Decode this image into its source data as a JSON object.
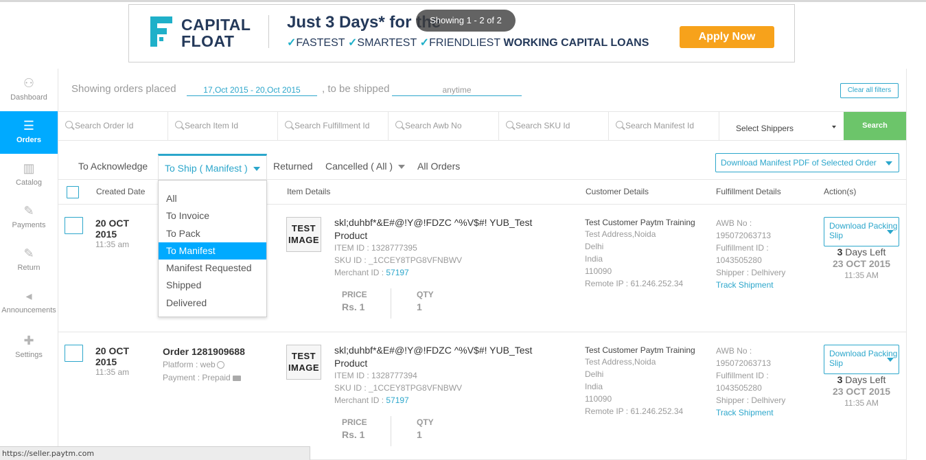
{
  "banner": {
    "logo_line1": "CAPITAL",
    "logo_line2": "FLOAT",
    "headline": "Just 3 Days* for the",
    "sub_fastest": "FASTEST",
    "sub_smartest": "SMARTEST",
    "sub_friendliest": "FRIENDLIEST",
    "sub_tail": "WORKING CAPITAL LOANS",
    "apply_label": "Apply Now",
    "brand_color": "#24395a",
    "accent_color": "#f7a21b"
  },
  "toast": "Showing 1 - 2 of 2",
  "sidebar": {
    "items": [
      {
        "label": "Dashboard",
        "icon": "dashboard-icon",
        "glyph": "⚇"
      },
      {
        "label": "Orders",
        "icon": "orders-icon",
        "glyph": "☰"
      },
      {
        "label": "Catalog",
        "icon": "catalog-icon",
        "glyph": "▥"
      },
      {
        "label": "Payments",
        "icon": "payments-icon",
        "glyph": "✎"
      },
      {
        "label": "Return",
        "icon": "return-icon",
        "glyph": "✎"
      },
      {
        "label": "Announcements",
        "icon": "megaphone-icon",
        "glyph": "◂"
      },
      {
        "label": "Settings",
        "icon": "wrench-icon",
        "glyph": "✚"
      }
    ]
  },
  "filters": {
    "prefix": "Showing orders placed",
    "date_range": "17,Oct 2015 - 20,Oct 2015",
    "ship_label": ", to be shipped",
    "ship_value": "anytime",
    "clear_label": "Clear all filters"
  },
  "search": {
    "order_id": "Search Order Id",
    "item_id": "Search Item Id",
    "fulfillment_id": "Search Fulfillment Id",
    "awb_no": "Search Awb No",
    "sku_id": "Search SKU Id",
    "manifest_id": "Search Manifest Id",
    "shipper_select": "Select Shippers",
    "search_btn": "Search"
  },
  "tabs": {
    "acknowledge": "To Acknowledge",
    "to_ship": "To Ship ( Manifest )",
    "returned": "Returned",
    "cancelled": "Cancelled ( All )",
    "all_orders": "All Orders",
    "download_manifest": "Download Manifest PDF of Selected Order"
  },
  "dropdown": {
    "items": [
      "All",
      "To Invoice",
      "To Pack",
      "To Manifest",
      "Manifest Requested",
      "Shipped",
      "Delivered"
    ],
    "selected": "To Manifest"
  },
  "table": {
    "headers": {
      "created": "Created Date",
      "item": "Item Details",
      "customer": "Customer Details",
      "fulfillment": "Fulfillment Details",
      "actions": "Action(s)"
    }
  },
  "rows": [
    {
      "date": "20 OCT 2015",
      "time": "11:35 am",
      "order": "",
      "platform": "",
      "payment": "",
      "thumb": "TEST IMAGE",
      "title": "skl;duhbf*&E#@!Y@!FDZC ^%V$#! YUB_Test Product",
      "item_id": "ITEM ID : 1328777395",
      "sku_id": "SKU ID : _1CCEY8TPG8VFNBWV",
      "merchant_label": "Merchant ID : ",
      "merchant_id": "57197",
      "price_label": "PRICE",
      "price": "Rs. 1",
      "qty_label": "QTY",
      "qty": "1",
      "customer_name": "Test Customer Paytm Training",
      "address": "Test Address,Noida",
      "city": "Delhi",
      "country": "India",
      "pin": "110090",
      "remote_ip": "Remote IP : 61.246.252.34",
      "awb_label": "AWB No :",
      "awb": "195072063713",
      "ful_label": "Fulfillment ID :",
      "ful_id": "1043505280",
      "shipper": "Shipper : Delhivery",
      "track": "Track Shipment",
      "download_slip": "Download Packing Slip",
      "days_num": "3",
      "days_text": " Days Left",
      "due_date": "23 OCT 2015",
      "due_time": "11:35 AM"
    },
    {
      "date": "20 OCT 2015",
      "time": "11:35 am",
      "order": "Order 1281909688",
      "platform": "Platform : web",
      "payment": "Payment : Prepaid",
      "thumb": "TEST IMAGE",
      "title": "skl;duhbf*&E#@!Y@!FDZC ^%V$#! YUB_Test Product",
      "item_id": "ITEM ID : 1328777394",
      "sku_id": "SKU ID : _1CCEY8TPG8VFNBWV",
      "merchant_label": "Merchant ID : ",
      "merchant_id": "57197",
      "price_label": "PRICE",
      "price": "Rs. 1",
      "qty_label": "QTY",
      "qty": "1",
      "customer_name": "Test Customer Paytm Training",
      "address": "Test Address,Noida",
      "city": "Delhi",
      "country": "India",
      "pin": "110090",
      "remote_ip": "Remote IP : 61.246.252.34",
      "awb_label": "AWB No :",
      "awb": "195072063713",
      "ful_label": "Fulfillment ID :",
      "ful_id": "1043505280",
      "shipper": "Shipper : Delhivery",
      "track": "Track Shipment",
      "download_slip": "Download Packing Slip",
      "days_num": "3",
      "days_text": " Days Left",
      "due_date": "23 OCT 2015",
      "due_time": "11:35 AM"
    }
  ],
  "status_url": "https://seller.paytm.com",
  "colors": {
    "accent": "#2ba6cb",
    "active_nav": "#00aaff",
    "search_button": "#6cc56a"
  }
}
